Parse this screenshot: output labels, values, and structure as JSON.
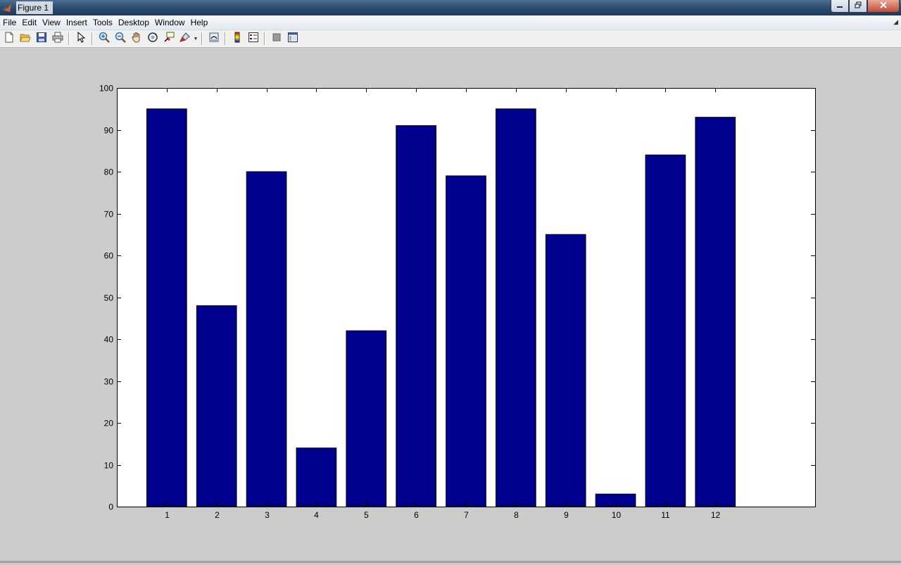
{
  "window": {
    "title": "Figure 1",
    "controls": {
      "minimize_icon": "minimize-icon",
      "restore_icon": "restore-icon",
      "close_icon": "close-icon"
    }
  },
  "menubar": {
    "items": [
      "File",
      "Edit",
      "View",
      "Insert",
      "Tools",
      "Desktop",
      "Window",
      "Help"
    ]
  },
  "toolbar": {
    "groups": [
      [
        "new-figure-icon",
        "open-file-icon",
        "save-icon",
        "print-icon"
      ],
      [
        "edit-plot-arrow-icon"
      ],
      [
        "zoom-in-icon",
        "zoom-out-icon",
        "pan-hand-icon",
        "rotate-3d-icon",
        "data-cursor-icon",
        "brush-icon"
      ],
      [
        "link-plot-icon"
      ],
      [
        "insert-colorbar-icon",
        "insert-legend-icon"
      ],
      [
        "hide-plot-tools-icon",
        "show-plot-tools-icon"
      ]
    ]
  },
  "colors": {
    "bar_fill": "#00008f",
    "axes_background": "#ffffff",
    "figure_background": "#cccccc"
  },
  "chart_data": {
    "type": "bar",
    "categories": [
      "1",
      "2",
      "3",
      "4",
      "5",
      "6",
      "7",
      "8",
      "9",
      "10",
      "11",
      "12"
    ],
    "values": [
      95,
      48,
      80,
      14,
      42,
      91,
      79,
      95,
      65,
      3,
      84,
      93
    ],
    "ylim": [
      0,
      100
    ],
    "xlim": [
      0,
      14
    ],
    "yticks": [
      0,
      10,
      20,
      30,
      40,
      50,
      60,
      70,
      80,
      90,
      100
    ],
    "xticks": [
      1,
      2,
      3,
      4,
      5,
      6,
      7,
      8,
      9,
      10,
      11,
      12
    ],
    "title": "",
    "xlabel": "",
    "ylabel": "",
    "grid": false
  }
}
